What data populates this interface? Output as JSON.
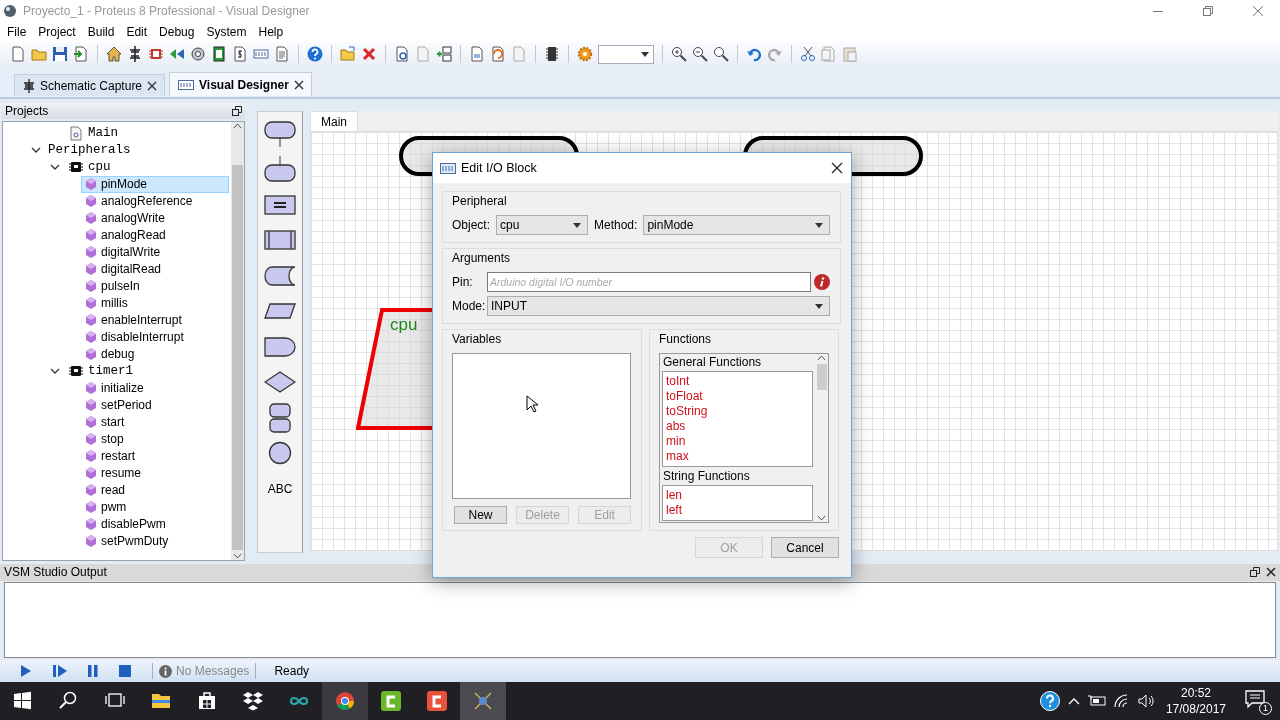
{
  "window": {
    "title": "Proyecto_1 - Proteus 8 Professional - Visual Designer"
  },
  "menu": [
    "File",
    "Project",
    "Build",
    "Edit",
    "Debug",
    "System",
    "Help"
  ],
  "doc_tabs": [
    {
      "label": "Schematic Capture",
      "selected": false
    },
    {
      "label": "Visual Designer",
      "selected": true
    }
  ],
  "projects": {
    "title": "Projects",
    "tree": [
      {
        "label": "Main",
        "kind": "file",
        "selected": false
      },
      {
        "label": "Peripherals",
        "kind": "folder",
        "selected": false,
        "expanded": true,
        "children": [
          {
            "label": "cpu",
            "kind": "chip",
            "selected": false,
            "expanded": true,
            "children": [
              {
                "label": "pinMode",
                "kind": "method",
                "selected": true
              },
              {
                "label": "analogReference",
                "kind": "method",
                "selected": false
              },
              {
                "label": "analogWrite",
                "kind": "method",
                "selected": false
              },
              {
                "label": "analogRead",
                "kind": "method",
                "selected": false
              },
              {
                "label": "digitalWrite",
                "kind": "method",
                "selected": false
              },
              {
                "label": "digitalRead",
                "kind": "method",
                "selected": false
              },
              {
                "label": "pulseIn",
                "kind": "method",
                "selected": false
              },
              {
                "label": "millis",
                "kind": "method",
                "selected": false
              },
              {
                "label": "enableInterrupt",
                "kind": "method",
                "selected": false
              },
              {
                "label": "disableInterrupt",
                "kind": "method",
                "selected": false
              },
              {
                "label": "debug",
                "kind": "method",
                "selected": false
              }
            ]
          },
          {
            "label": "timer1",
            "kind": "chip",
            "selected": false,
            "expanded": true,
            "children": [
              {
                "label": "initialize",
                "kind": "method",
                "selected": false
              },
              {
                "label": "setPeriod",
                "kind": "method",
                "selected": false
              },
              {
                "label": "start",
                "kind": "method",
                "selected": false
              },
              {
                "label": "stop",
                "kind": "method",
                "selected": false
              },
              {
                "label": "restart",
                "kind": "method",
                "selected": false
              },
              {
                "label": "resume",
                "kind": "method",
                "selected": false
              },
              {
                "label": "read",
                "kind": "method",
                "selected": false
              },
              {
                "label": "pwm",
                "kind": "method",
                "selected": false
              },
              {
                "label": "disablePwm",
                "kind": "method",
                "selected": false
              },
              {
                "label": "setPwmDuty",
                "kind": "method",
                "selected": false
              }
            ]
          }
        ]
      }
    ]
  },
  "palette": {
    "text_tool": "ABC"
  },
  "canvas": {
    "tab": "Main",
    "blocks": [
      {
        "kind": "terminator"
      },
      {
        "kind": "terminator"
      },
      {
        "kind": "io",
        "label": "cpu"
      }
    ]
  },
  "dialog": {
    "title": "Edit I/O Block",
    "peripheral": {
      "title": "Peripheral",
      "object_label": "Object:",
      "object": "cpu",
      "method_label": "Method:",
      "method": "pinMode"
    },
    "arguments": {
      "title": "Arguments",
      "pin_label": "Pin:",
      "pin_placeholder": "Arduino digital I/O number",
      "mode_label": "Mode:",
      "mode": "INPUT"
    },
    "variables": {
      "title": "Variables",
      "buttons": [
        {
          "label": "New",
          "disabled": false
        },
        {
          "label": "Delete",
          "disabled": true
        },
        {
          "label": "Edit",
          "disabled": true
        }
      ]
    },
    "functions": {
      "title": "Functions",
      "groups": [
        {
          "title": "General Functions",
          "items": [
            "toInt",
            "toFloat",
            "toString",
            "abs",
            "min",
            "max"
          ]
        },
        {
          "title": "String Functions",
          "items": [
            "len",
            "left"
          ]
        }
      ]
    },
    "buttons": [
      {
        "label": "OK",
        "disabled": true
      },
      {
        "label": "Cancel",
        "disabled": false
      }
    ]
  },
  "output": {
    "title": "VSM Studio Output"
  },
  "status_bar": {
    "messages": "No Messages",
    "state": "Ready"
  },
  "taskbar": {
    "time": "20:52",
    "date": "17/08/2017",
    "notifications": "1"
  }
}
